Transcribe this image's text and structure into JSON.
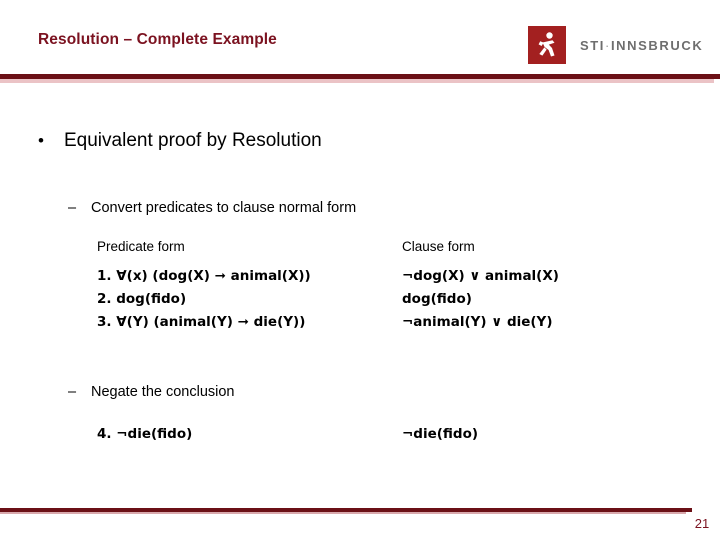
{
  "slide": {
    "title": "Resolution – Complete Example",
    "page_number": "21",
    "accent_color": "#7B1220",
    "rule_color": "#6B1016",
    "rule_light_color": "#EBC3C6",
    "logo": {
      "mark_color": "#A32020",
      "mark_icon": "running-figure-icon",
      "brand": "STI",
      "separator": "·",
      "location": "INNSBRUCK"
    }
  },
  "content": {
    "main_bullet": {
      "marker": "•",
      "text": "Equivalent proof by Resolution"
    },
    "sections": [
      {
        "marker": "–",
        "heading": "Convert predicates to clause normal form",
        "columns": {
          "left_header": "Predicate form",
          "right_header": "Clause form"
        },
        "rows": [
          {
            "predicate": "1. ∀(x) (dog(X) ➞ animal(X))",
            "clause": "¬dog(X) ∨ animal(X)"
          },
          {
            "predicate": "2. dog(fido)",
            "clause": "dog(fido)"
          },
          {
            "predicate": "3. ∀(Y) (animal(Y) ➞ die(Y))",
            "clause": "¬animal(Y) ∨ die(Y)"
          }
        ]
      },
      {
        "marker": "–",
        "heading": "Negate the conclusion",
        "rows": [
          {
            "predicate": "4. ¬die(fido)",
            "clause": "¬die(fido)"
          }
        ]
      }
    ]
  }
}
